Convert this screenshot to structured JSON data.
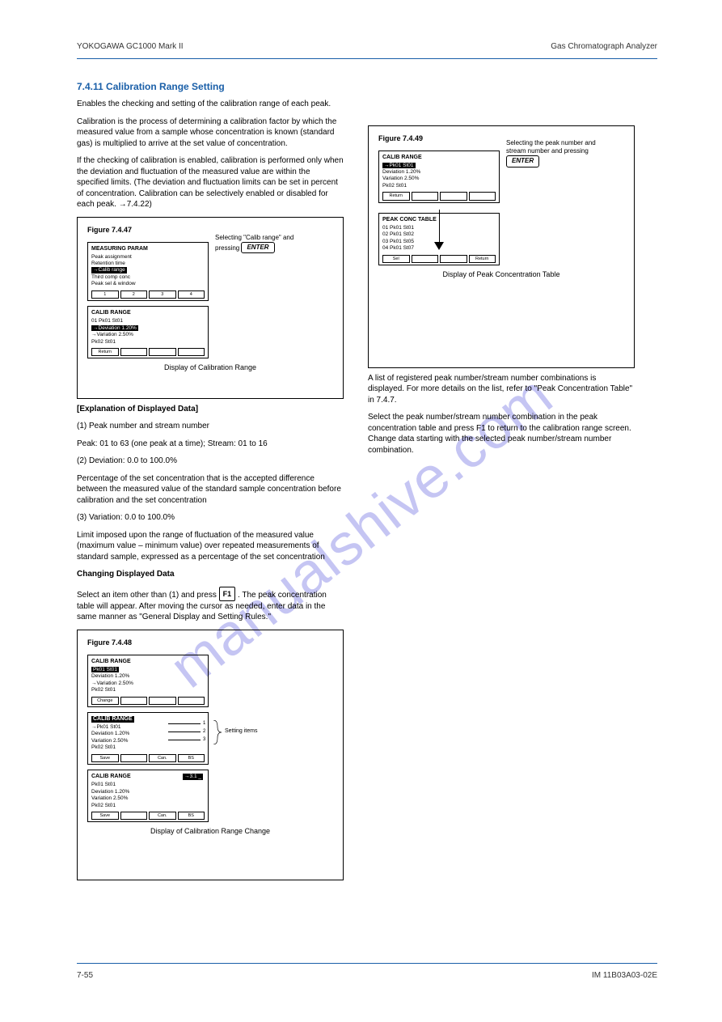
{
  "header": {
    "left": "YOKOGAWA  GC1000 Mark II",
    "right": "Gas Chromatograph Analyzer",
    "page": "7-55",
    "doc": "IM 11B03A03-02E"
  },
  "watermark": "manualshive.com",
  "keys": {
    "enter": "ENTER",
    "f1": "F1"
  },
  "left_column": {
    "h4_1": "7.4.11  Calibration Range Setting",
    "p1": "Enables the checking and setting of the calibration range of each peak.",
    "p2": "Calibration is the process of determining a calibration factor by which the measured value from a sample whose concentration is known (standard gas) is multiplied to arrive at the set value of concentration.",
    "p3": "If the checking of calibration is enabled, calibration is performed only when the deviation and fluctuation of the measured value are within the specified limits. (The deviation and fluctuation limits can be set in percent of concentration. Calibration can be selectively enabled or disabled for each peak. →7.4.22)",
    "figure1": {
      "caption": "Figure 7.4.47",
      "title": "Display of Calibration Range",
      "lcd1": {
        "title": "MEASURING PARAM",
        "lines": [
          " Peak assignment ",
          " Retention time ",
          "→Calib range ",
          " Third comp conc ",
          " Peak sel & window"
        ],
        "tabs": [
          "1",
          "2",
          "3",
          "4"
        ]
      },
      "lcd2": {
        "title": "CALIB RANGE",
        "lines": [
          "01 Pk01 St01",
          "→Deviation  1.20%",
          "→Variation  2.50%",
          " Pk02 St01"
        ],
        "tabs": [
          "Return",
          " ",
          " ",
          " "
        ]
      },
      "anno": "Selecting \"Calib range\" and pressing "
    },
    "desc_block": [
      "[Explanation of Displayed Data]",
      "(1)  Peak number and stream number",
      "Peak: 01 to 63 (one peak at a time); Stream: 01 to 16",
      "(2)  Deviation: 0.0 to 100.0%",
      "Percentage of the set concentration that is the accepted difference between the measured value of the standard sample concentration before calibration and the set concentration",
      "(3)  Variation: 0.0 to 100.0%",
      "Limit imposed upon the range of fluctuation of the measured value (maximum value – minimum value) over repeated measurements of standard sample, expressed as a percentage of the set concentration"
    ],
    "change_h": "Changing Displayed Data",
    "change_p": "Select an item other than (1) and press ",
    "change_p_tail": ". The peak concentration table will appear. After moving the cursor as needed, enter data in the same manner as \"General Display and Setting Rules.\"",
    "figure2": {
      "caption": "Figure 7.4.48",
      "title": "Display of Calibration Range Change",
      "lcd1": {
        "title": "CALIB RANGE",
        "lines": [
          " Pk01 St01",
          " Deviation  1.20%",
          "→Variation  2.50%",
          " Pk02 St01"
        ],
        "tabs": [
          "Change",
          " ",
          " ",
          " "
        ]
      },
      "lcd2": {
        "title": "CALIB RANGE",
        "lines": [
          "→Pk01 St01",
          " Deviation  1.20%",
          " Variation  2.50%",
          " Pk02 St01"
        ],
        "tabs": [
          "Save",
          " ",
          "Can.",
          "BS"
        ],
        "brace_lines": [
          "1",
          "2",
          "3"
        ],
        "brace_label": "Setting items"
      },
      "lcd3": {
        "title": "CALIB RANGE",
        "lines": [
          " Pk01 St01",
          " Deviation  1.20%",
          " Variation  2.50%",
          " Pk02 St01"
        ],
        "corner": "→3.1 _",
        "tabs": [
          "Save",
          " ",
          "Can.",
          "BS"
        ]
      }
    }
  },
  "right_column": {
    "figure3": {
      "caption": "Figure 7.4.49",
      "title": "Display of Peak Concentration Table",
      "anno": "Selecting the peak number and stream number and pressing ",
      "lcd1": {
        "title": "CALIB RANGE",
        "lines": [
          "→Pk01 St01",
          " Deviation  1.20%",
          " Variation  2.50%",
          " Pk02 St01"
        ],
        "tabs": [
          "Return",
          " ",
          " ",
          " "
        ]
      },
      "lcd2": {
        "title": "PEAK CONC TABLE",
        "lines": [
          " 01 Pk01  St01",
          " 02 Pk01  St02",
          " 03 Pk01  St05",
          " 04 Pk01  St07"
        ],
        "tabs": [
          "Sel",
          " ",
          " ",
          "Return"
        ]
      }
    },
    "under_p": "A list of registered peak number/stream number combinations is displayed. For more details on the list, refer to \"Peak Concentration Table\" in 7.4.7.",
    "tail_p": "Select the peak number/stream number combination in the peak concentration table and press F1 to return to the calibration range screen. Change data starting with the selected peak number/stream number combination."
  }
}
